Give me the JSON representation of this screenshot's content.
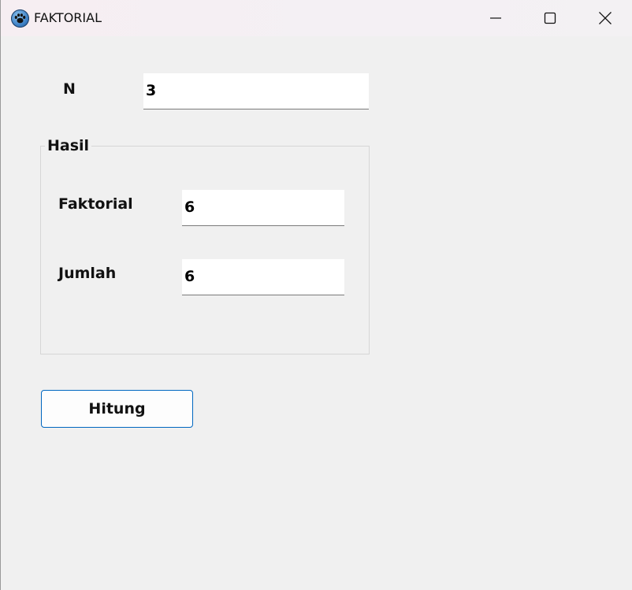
{
  "window": {
    "title": "FAKTORIAL",
    "icon": "paw-icon",
    "controls": {
      "minimize": "minimize-icon",
      "maximize": "maximize-icon",
      "close": "close-icon"
    }
  },
  "form": {
    "n_label": "N",
    "n_value": "3",
    "group_title": "Hasil",
    "faktorial_label": "Faktorial",
    "faktorial_value": "6",
    "jumlah_label": "Jumlah",
    "jumlah_value": "6",
    "button_label": "Hitung"
  },
  "colors": {
    "accent": "#0067c0",
    "window_bg": "#f0f0f0"
  }
}
